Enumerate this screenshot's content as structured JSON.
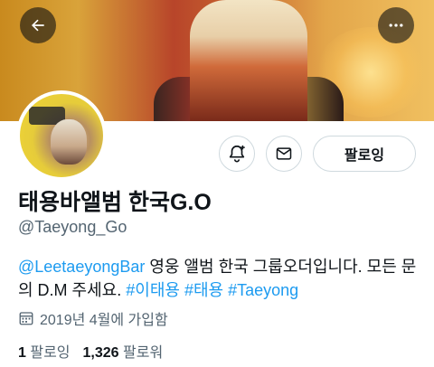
{
  "header": {
    "back_icon": "arrow-left-icon",
    "more_icon": "more-horizontal-icon"
  },
  "profile": {
    "display_name": "태용바앨범 한국G.O",
    "handle": "@Taeyong_Go",
    "bio": {
      "mention": "@LeetaeyongBar",
      "text_1": " 영웅 앨범 한국 그룹오더입니다. 모든 문의 D.M 주세요. ",
      "hashtags": [
        "#이태용",
        "#태용",
        "#Taeyong"
      ]
    },
    "joined": "2019년 4월에 가입함",
    "following_count": "1",
    "following_label": "팔로잉",
    "followers_count": "1,326",
    "followers_label": "팔로워"
  },
  "actions": {
    "notify_icon": "bell-plus-icon",
    "message_icon": "mail-icon",
    "follow_label": "팔로잉"
  },
  "colors": {
    "link": "#1d9bf0",
    "text_primary": "#0f1419",
    "text_secondary": "#536471",
    "border": "#cfd9de"
  }
}
